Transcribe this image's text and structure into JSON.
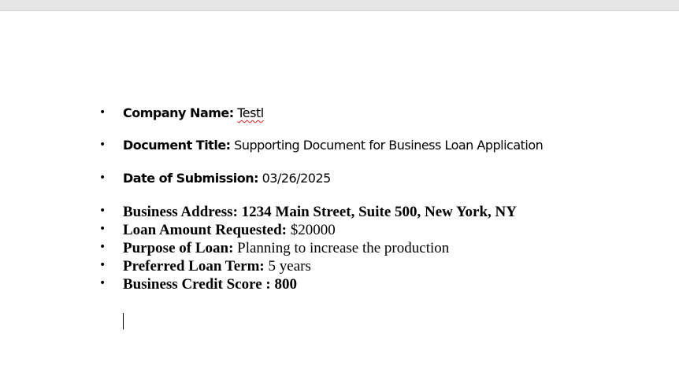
{
  "items": [
    {
      "label": "Company Name:",
      "value": "Testl"
    },
    {
      "label": "Document Title:",
      "value": "Supporting Document for Business Loan Application"
    },
    {
      "label": "Date of Submission:",
      "value": "03/26/2025"
    },
    {
      "label": "Business Address: 1234 Main Street, Suite 500, New York, NY",
      "value": ""
    },
    {
      "label": "Loan Amount Requested:",
      "value": "$20000"
    },
    {
      "label": "Purpose of Loan:",
      "value": "Planning to increase the production"
    },
    {
      "label": "Preferred Loan Term:",
      "value": "5 years"
    },
    {
      "label": "Business Credit Score : 800",
      "value": ""
    }
  ],
  "bullet_glyph": "•",
  "spellcheck_color": "#e02020"
}
